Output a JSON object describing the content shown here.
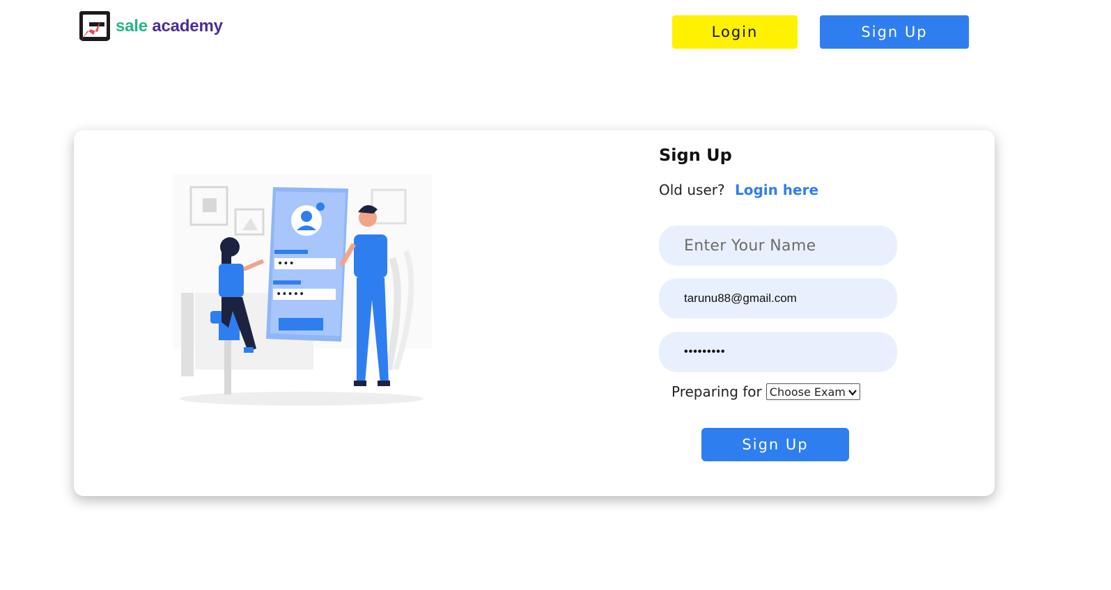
{
  "brand": {
    "word1": "sale",
    "word2": "academy",
    "colors": {
      "green": "#25b684",
      "purple": "#4b2e91",
      "mark_dark": "#1c1c1c",
      "mark_red": "#e8465a"
    }
  },
  "header": {
    "login_label": "Login",
    "signup_label": "Sign Up"
  },
  "form": {
    "title": "Sign Up",
    "old_user_text": "Old user?",
    "login_link": "Login here",
    "name_placeholder": "Enter Your Name",
    "email_value": "tarunu88@gmail.com",
    "password_masked": "•••••••••",
    "preparing_label": "Preparing for",
    "exam_select_value": "Choose Exam",
    "submit_label": "Sign Up"
  },
  "illustration": {
    "icon": "signup-illustration",
    "screen_field_1_dots": "•••",
    "screen_field_2_dots": "•••••"
  },
  "colors": {
    "accent_blue": "#2e7ef0",
    "login_yellow": "#fff100",
    "field_bg": "#e9f0fd"
  }
}
